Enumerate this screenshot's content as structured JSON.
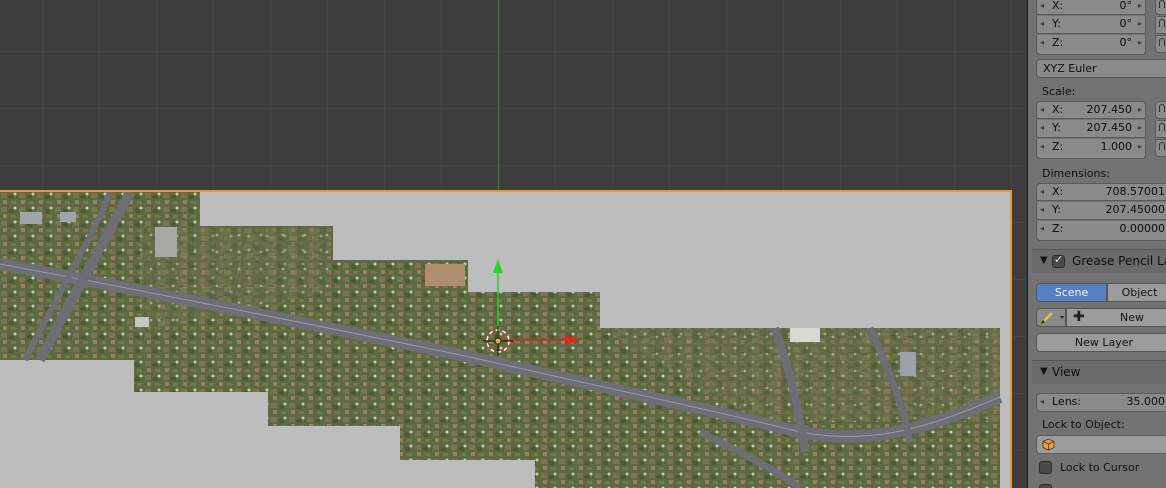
{
  "rotation": {
    "x": {
      "label": "X:",
      "value": "0°"
    },
    "y": {
      "label": "Y:",
      "value": "0°"
    },
    "z": {
      "label": "Z:",
      "value": "0°"
    },
    "mode": "XYZ Euler"
  },
  "scale": {
    "heading": "Scale:",
    "x": {
      "label": "X:",
      "value": "207.450"
    },
    "y": {
      "label": "Y:",
      "value": "207.450"
    },
    "z": {
      "label": "Z:",
      "value": "1.000"
    }
  },
  "dimensions": {
    "heading": "Dimensions:",
    "x": {
      "label": "X:",
      "value": "708.57001"
    },
    "y": {
      "label": "Y:",
      "value": "207.45000"
    },
    "z": {
      "label": "Z:",
      "value": "0.00000"
    }
  },
  "grease_pencil": {
    "title": "Grease Pencil Lay",
    "checked": true,
    "tabs": [
      "Scene",
      "Object"
    ],
    "active_tab": "Scene",
    "new_label": "New",
    "new_layer_label": "New Layer"
  },
  "view": {
    "title": "View",
    "lens": {
      "label": "Lens:",
      "value": "35.000"
    },
    "lock_to_object_label": "Lock to Object:",
    "lock_to_cursor_label": "Lock to Cursor",
    "lock_to_cursor_checked": false
  },
  "icons": {
    "arrow_left": "◂",
    "arrow_right": "▸",
    "triangle_down": "▼",
    "plus": "plus-icon",
    "pencil": "pencil-icon",
    "cube": "cube-icon",
    "lock": "lock-icon"
  },
  "colors": {
    "selection_outline": "#e29a3b",
    "axis_y": "#2f8f2f",
    "gizmo_x": "#e0241a",
    "gizmo_y": "#2fd12f",
    "active_tab": "#5680c2"
  }
}
